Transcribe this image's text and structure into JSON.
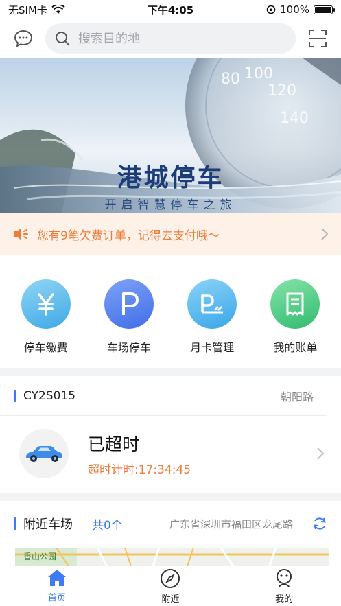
{
  "status_bar": {
    "carrier": "无SIM卡",
    "time": "下午4:05",
    "battery": "100%"
  },
  "search": {
    "placeholder": "搜索目的地"
  },
  "banner": {
    "title": "港城停车",
    "subtitle": "开启智慧停车之旅"
  },
  "notice": {
    "text": "您有9笔欠费订单，记得去支付哦～"
  },
  "quick_actions": [
    {
      "label": "停车缴费",
      "icon": "yen-icon",
      "color": "#4fb6ea"
    },
    {
      "label": "车场停车",
      "icon": "parking-icon",
      "color": "#4a7cf0"
    },
    {
      "label": "月卡管理",
      "icon": "monthly-card-icon",
      "color": "#3fb0ee"
    },
    {
      "label": "我的账单",
      "icon": "bill-icon",
      "color": "#35c27a"
    }
  ],
  "parking_card": {
    "plate": "CY2S015",
    "road": "朝阳路",
    "state": "已超时",
    "timer": "超时计时:17:34:45"
  },
  "nearby": {
    "title": "附近车场",
    "count": "共0个",
    "address": "广东省深圳市福田区龙尾路",
    "map_poi": "香山公园"
  },
  "tabs": [
    {
      "label": "首页",
      "active": true
    },
    {
      "label": "附近",
      "active": false
    },
    {
      "label": "我的",
      "active": false
    }
  ],
  "colors": {
    "accent": "#3e7cf6",
    "warning": "#ef7a3a"
  }
}
